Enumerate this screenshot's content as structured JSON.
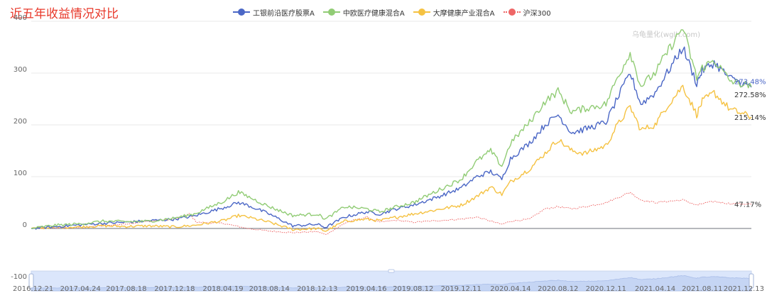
{
  "page": {
    "title": "近五年收益情况对比",
    "watermark": "乌龟量化(wglh.com)"
  },
  "colors": {
    "title": "#e8392b",
    "axis_text": "#666666",
    "grid": "#e9e9e9",
    "slider_fill": "#dbe6fb",
    "slider_border": "#c9d6ee"
  },
  "chart_data": {
    "type": "line",
    "title": "近五年收益情况对比",
    "xlabel": "",
    "ylabel": "",
    "ylim": [
      -100,
      400
    ],
    "yticks": [
      -100,
      0,
      100,
      200,
      300,
      400
    ],
    "grid": true,
    "legend_position": "top-center",
    "x_range": [
      "2016-12-21",
      "2021-12-13"
    ],
    "x_ticks": [
      "2016.12.21",
      "2017.04.24",
      "2017.08.18",
      "2017.12.18",
      "2018.04.19",
      "2018.08.14",
      "2018.12.13",
      "2019.04.16",
      "2019.08.12",
      "2019.12.11",
      "2020.04.14",
      "2020.08.12",
      "2020.12.11",
      "2021.04.14",
      "2021.08.11",
      "2021.12.13"
    ],
    "series": [
      {
        "name": "工银前沿医疗股票A",
        "color": "#4b67c6",
        "style": "solid",
        "end_label": "272.58%",
        "points": [
          [
            "2016-12-21",
            0
          ],
          [
            "2017-02-15",
            3
          ],
          [
            "2017-04-24",
            7
          ],
          [
            "2017-06-20",
            10
          ],
          [
            "2017-08-18",
            12
          ],
          [
            "2017-10-16",
            15
          ],
          [
            "2017-12-18",
            18
          ],
          [
            "2018-02-05",
            24
          ],
          [
            "2018-04-19",
            40
          ],
          [
            "2018-05-28",
            50
          ],
          [
            "2018-06-20",
            45
          ],
          [
            "2018-08-14",
            28
          ],
          [
            "2018-10-12",
            5
          ],
          [
            "2018-12-13",
            8
          ],
          [
            "2019-01-03",
            2
          ],
          [
            "2019-02-20",
            22
          ],
          [
            "2019-04-16",
            32
          ],
          [
            "2019-05-20",
            28
          ],
          [
            "2019-07-01",
            38
          ],
          [
            "2019-08-12",
            45
          ],
          [
            "2019-10-10",
            60
          ],
          [
            "2019-12-11",
            78
          ],
          [
            "2020-01-20",
            100
          ],
          [
            "2020-02-24",
            110
          ],
          [
            "2020-03-23",
            95
          ],
          [
            "2020-04-14",
            135
          ],
          [
            "2020-06-01",
            165
          ],
          [
            "2020-07-10",
            200
          ],
          [
            "2020-08-12",
            220
          ],
          [
            "2020-09-15",
            185
          ],
          [
            "2020-10-20",
            192
          ],
          [
            "2020-12-11",
            205
          ],
          [
            "2021-01-05",
            245
          ],
          [
            "2021-02-10",
            300
          ],
          [
            "2021-03-09",
            240
          ],
          [
            "2021-04-14",
            262
          ],
          [
            "2021-05-10",
            295
          ],
          [
            "2021-06-23",
            350
          ],
          [
            "2021-07-28",
            280
          ],
          [
            "2021-08-11",
            305
          ],
          [
            "2021-09-10",
            320
          ],
          [
            "2021-10-20",
            290
          ],
          [
            "2021-12-13",
            272.58
          ]
        ]
      },
      {
        "name": "中欧医疗健康混合A",
        "color": "#91cc75",
        "style": "solid",
        "end_label": "273.48%",
        "points": [
          [
            "2016-12-21",
            0
          ],
          [
            "2017-02-15",
            6
          ],
          [
            "2017-04-24",
            9
          ],
          [
            "2017-06-20",
            14
          ],
          [
            "2017-08-18",
            13
          ],
          [
            "2017-10-16",
            14
          ],
          [
            "2017-12-18",
            20
          ],
          [
            "2018-02-05",
            28
          ],
          [
            "2018-04-19",
            52
          ],
          [
            "2018-05-28",
            70
          ],
          [
            "2018-06-20",
            62
          ],
          [
            "2018-08-14",
            42
          ],
          [
            "2018-10-12",
            25
          ],
          [
            "2018-12-13",
            28
          ],
          [
            "2019-01-03",
            18
          ],
          [
            "2019-02-20",
            42
          ],
          [
            "2019-04-16",
            38
          ],
          [
            "2019-05-20",
            32
          ],
          [
            "2019-07-01",
            42
          ],
          [
            "2019-08-12",
            50
          ],
          [
            "2019-10-10",
            72
          ],
          [
            "2019-12-11",
            95
          ],
          [
            "2020-01-20",
            130
          ],
          [
            "2020-02-24",
            150
          ],
          [
            "2020-03-23",
            120
          ],
          [
            "2020-04-14",
            165
          ],
          [
            "2020-06-01",
            205
          ],
          [
            "2020-07-10",
            245
          ],
          [
            "2020-08-12",
            265
          ],
          [
            "2020-09-15",
            225
          ],
          [
            "2020-10-20",
            232
          ],
          [
            "2020-12-11",
            240
          ],
          [
            "2021-01-05",
            285
          ],
          [
            "2021-02-10",
            340
          ],
          [
            "2021-03-09",
            275
          ],
          [
            "2021-04-14",
            300
          ],
          [
            "2021-05-10",
            335
          ],
          [
            "2021-06-23",
            388
          ],
          [
            "2021-07-28",
            290
          ],
          [
            "2021-08-11",
            310
          ],
          [
            "2021-09-10",
            325
          ],
          [
            "2021-10-20",
            285
          ],
          [
            "2021-12-13",
            273.48
          ]
        ]
      },
      {
        "name": "大摩健康产业混合A",
        "color": "#f5c242",
        "style": "solid",
        "end_label": "215.14%",
        "points": [
          [
            "2016-12-21",
            0
          ],
          [
            "2017-02-15",
            2
          ],
          [
            "2017-04-24",
            3
          ],
          [
            "2017-06-20",
            5
          ],
          [
            "2017-08-18",
            4
          ],
          [
            "2017-10-16",
            5
          ],
          [
            "2017-12-18",
            3
          ],
          [
            "2018-02-05",
            6
          ],
          [
            "2018-04-19",
            15
          ],
          [
            "2018-05-28",
            25
          ],
          [
            "2018-06-20",
            22
          ],
          [
            "2018-08-14",
            12
          ],
          [
            "2018-10-12",
            -2
          ],
          [
            "2018-12-13",
            0
          ],
          [
            "2019-01-03",
            -5
          ],
          [
            "2019-02-20",
            14
          ],
          [
            "2019-04-16",
            18
          ],
          [
            "2019-05-20",
            15
          ],
          [
            "2019-07-01",
            22
          ],
          [
            "2019-08-12",
            28
          ],
          [
            "2019-10-10",
            36
          ],
          [
            "2019-12-11",
            45
          ],
          [
            "2020-01-20",
            62
          ],
          [
            "2020-02-24",
            80
          ],
          [
            "2020-03-23",
            66
          ],
          [
            "2020-04-14",
            90
          ],
          [
            "2020-06-01",
            115
          ],
          [
            "2020-07-10",
            145
          ],
          [
            "2020-08-12",
            172
          ],
          [
            "2020-09-15",
            150
          ],
          [
            "2020-10-20",
            145
          ],
          [
            "2020-12-11",
            160
          ],
          [
            "2021-01-05",
            195
          ],
          [
            "2021-02-10",
            235
          ],
          [
            "2021-03-09",
            190
          ],
          [
            "2021-04-14",
            200
          ],
          [
            "2021-05-10",
            232
          ],
          [
            "2021-06-23",
            275
          ],
          [
            "2021-07-28",
            220
          ],
          [
            "2021-08-11",
            245
          ],
          [
            "2021-09-10",
            262
          ],
          [
            "2021-10-20",
            230
          ],
          [
            "2021-12-13",
            215.14
          ]
        ]
      },
      {
        "name": "沪深300",
        "color": "#ee6666",
        "style": "dotted",
        "end_label": "47.17%",
        "points": [
          [
            "2016-12-21",
            0
          ],
          [
            "2017-02-15",
            1
          ],
          [
            "2017-04-24",
            2
          ],
          [
            "2017-06-20",
            5
          ],
          [
            "2017-08-18",
            9
          ],
          [
            "2017-10-16",
            14
          ],
          [
            "2017-12-18",
            18
          ],
          [
            "2018-01-24",
            28
          ],
          [
            "2018-02-12",
            12
          ],
          [
            "2018-04-19",
            10
          ],
          [
            "2018-06-20",
            0
          ],
          [
            "2018-08-14",
            -5
          ],
          [
            "2018-10-12",
            -8
          ],
          [
            "2018-12-13",
            -6
          ],
          [
            "2019-01-03",
            -12
          ],
          [
            "2019-02-25",
            12
          ],
          [
            "2019-04-16",
            22
          ],
          [
            "2019-05-20",
            12
          ],
          [
            "2019-07-01",
            16
          ],
          [
            "2019-08-12",
            12
          ],
          [
            "2019-10-10",
            15
          ],
          [
            "2019-12-11",
            18
          ],
          [
            "2020-01-20",
            22
          ],
          [
            "2020-03-23",
            8
          ],
          [
            "2020-04-14",
            14
          ],
          [
            "2020-06-01",
            18
          ],
          [
            "2020-07-10",
            38
          ],
          [
            "2020-08-12",
            42
          ],
          [
            "2020-09-15",
            38
          ],
          [
            "2020-10-20",
            42
          ],
          [
            "2020-12-11",
            50
          ],
          [
            "2021-01-05",
            58
          ],
          [
            "2021-02-10",
            70
          ],
          [
            "2021-03-09",
            55
          ],
          [
            "2021-04-14",
            50
          ],
          [
            "2021-05-10",
            52
          ],
          [
            "2021-06-23",
            55
          ],
          [
            "2021-07-28",
            45
          ],
          [
            "2021-08-11",
            48
          ],
          [
            "2021-09-10",
            52
          ],
          [
            "2021-10-20",
            48
          ],
          [
            "2021-12-13",
            47.17
          ]
        ]
      }
    ]
  }
}
